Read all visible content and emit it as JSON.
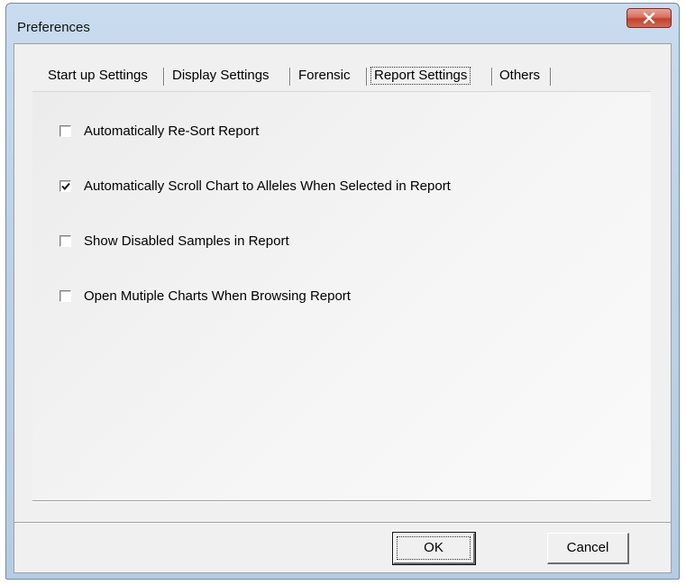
{
  "window": {
    "title": "Preferences"
  },
  "tabs": [
    {
      "label": "Start up Settings"
    },
    {
      "label": "Display Settings"
    },
    {
      "label": "Forensic"
    },
    {
      "label": "Report Settings",
      "active": true
    },
    {
      "label": "Others"
    }
  ],
  "options": [
    {
      "label": "Automatically Re-Sort Report",
      "checked": false
    },
    {
      "label": "Automatically Scroll Chart to Alleles When Selected in Report",
      "checked": true
    },
    {
      "label": "Show Disabled Samples in Report",
      "checked": false
    },
    {
      "label": "Open Mutiple Charts When Browsing Report",
      "checked": false
    }
  ],
  "buttons": {
    "ok": "OK",
    "cancel": "Cancel"
  },
  "colors": {
    "titlebar": "#bcd2e9",
    "close": "#c2412c",
    "client": "#f0f0f0"
  }
}
